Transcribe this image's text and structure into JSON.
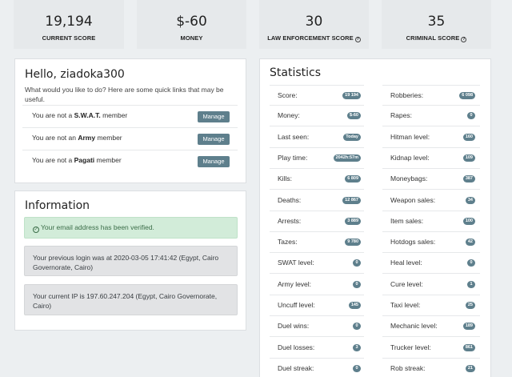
{
  "stats_cards": [
    {
      "value": "19,194",
      "label": "CURRENT SCORE",
      "help": false
    },
    {
      "value": "$-60",
      "label": "MONEY",
      "help": false
    },
    {
      "value": "30",
      "label": "LAW ENFORCEMENT SCORE",
      "help": true
    },
    {
      "value": "35",
      "label": "CRIMINAL SCORE",
      "help": true
    }
  ],
  "welcome": {
    "title": "Hello, ziadoka300",
    "subtitle": "What would you like to do? Here are some quick links that may be useful.",
    "rows": [
      {
        "prefix": "You are not a",
        "group": "S.W.A.T.",
        "suffix": "member",
        "button": "Manage"
      },
      {
        "prefix": "You are not an",
        "group": "Army",
        "suffix": "member",
        "button": "Manage"
      },
      {
        "prefix": "You are not a",
        "group": "Pagati",
        "suffix": "member",
        "button": "Manage"
      }
    ]
  },
  "information": {
    "title": "Information",
    "success": "Your email address has been verified.",
    "previous_login": "Your previous login was at 2020-03-05 17:41:42 (Egypt, Cairo Governorate, Cairo)",
    "current_ip": "Your current IP is 197.60.247.204 (Egypt, Cairo Governorate, Cairo)"
  },
  "statistics": {
    "title": "Statistics",
    "left": [
      {
        "label": "Score:",
        "value": "19 194"
      },
      {
        "label": "Money:",
        "value": "$-60"
      },
      {
        "label": "Last seen:",
        "value": "Today"
      },
      {
        "label": "Play time:",
        "value": "2042h:57m"
      },
      {
        "label": "Kills:",
        "value": "6 809"
      },
      {
        "label": "Deaths:",
        "value": "12 867"
      },
      {
        "label": "Arrests:",
        "value": "3 889"
      },
      {
        "label": "Tazes:",
        "value": "9 780"
      },
      {
        "label": "SWAT level:",
        "value": "0"
      },
      {
        "label": "Army level:",
        "value": "0"
      },
      {
        "label": "Uncuff level:",
        "value": "145"
      },
      {
        "label": "Duel wins:",
        "value": "0"
      },
      {
        "label": "Duel losses:",
        "value": "3"
      },
      {
        "label": "Duel streak:",
        "value": "0"
      }
    ],
    "right": [
      {
        "label": "Robberies:",
        "value": "6 098"
      },
      {
        "label": "Rapes:",
        "value": "0"
      },
      {
        "label": "Hitman level:",
        "value": "160"
      },
      {
        "label": "Kidnap level:",
        "value": "109"
      },
      {
        "label": "Moneybags:",
        "value": "387"
      },
      {
        "label": "Weapon sales:",
        "value": "34"
      },
      {
        "label": "Item sales:",
        "value": "100"
      },
      {
        "label": "Hotdogs sales:",
        "value": "42"
      },
      {
        "label": "Heal level:",
        "value": "0"
      },
      {
        "label": "Cure level:",
        "value": "1"
      },
      {
        "label": "Taxi level:",
        "value": "25"
      },
      {
        "label": "Mechanic level:",
        "value": "189"
      },
      {
        "label": "Trucker level:",
        "value": "861"
      },
      {
        "label": "Rob streak:",
        "value": "21"
      }
    ]
  }
}
